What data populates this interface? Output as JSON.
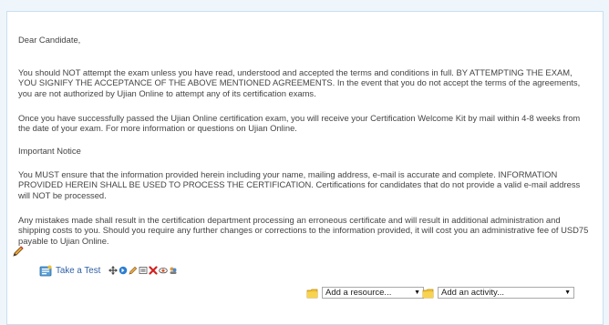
{
  "content": {
    "greeting": "Dear Candidate,",
    "para1": "You should NOT attempt the exam unless you have read, understood and accepted the terms and conditions in full. BY ATTEMPTING THE EXAM, YOU SIGNIFY THE ACCEPTANCE OF THE ABOVE MENTIONED AGREEMENTS. In the event that you do not accept the terms of the agreements, you are not authorized by Ujian Online to attempt any of its certification exams.",
    "para2": "Once you have successfully passed the Ujian Online certification exam, you will receive your Certification Welcome Kit by mail within 4-8 weeks from the date of your exam. For more information or questions on Ujian Online.",
    "notice_heading": "Important Notice",
    "para3": "You MUST ensure that the information provided herein including your name, mailing address, e-mail is accurate and complete. INFORMATION PROVIDED HEREIN SHALL BE USED TO PROCESS THE CERTIFICATION. Certifications for candidates that do not provide a valid e-mail address will NOT be processed.",
    "para4": "Any mistakes made shall result in the certification department processing an erroneous certificate and will result in additional administration and shipping costs to you. Should you require any further changes or corrections to the information provided, it will cost you an administrative fee of USD75 payable to Ujian Online."
  },
  "activity": {
    "label": "Take a Test",
    "icon": "quiz-icon",
    "tools": [
      "move-icon",
      "indent-right-icon",
      "edit-icon",
      "roles-icon",
      "delete-icon",
      "hide-eye-icon",
      "group-mode-icon"
    ]
  },
  "add_resource": {
    "selected": "Add a resource...",
    "icon": "folder-icon"
  },
  "add_activity": {
    "selected": "Add an activity...",
    "icon": "folder-icon"
  },
  "colors": {
    "link": "#2e5fa5",
    "text": "#444444",
    "background": "#eef6fb",
    "border": "#c9dff0"
  }
}
